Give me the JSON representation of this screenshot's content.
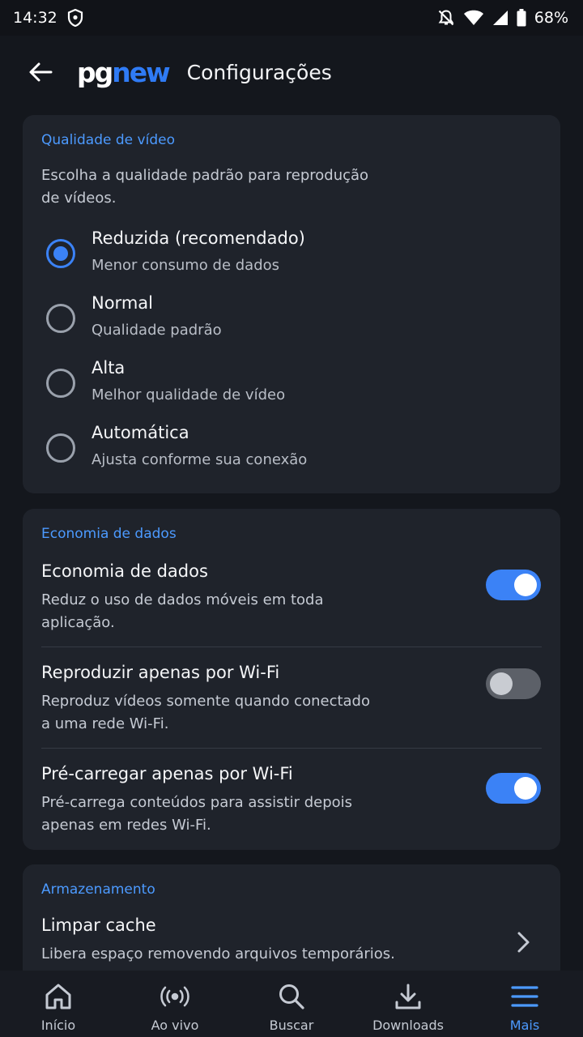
{
  "status_bar": {
    "time": "14:32",
    "battery": "68%",
    "icons": [
      "shield-icon",
      "notifications-off-icon",
      "wifi-icon",
      "signal-icon",
      "battery-icon"
    ]
  },
  "app_bar": {
    "logo_part1": "pg",
    "logo_part2": "new",
    "title": "Configurações",
    "back_icon": "arrow-back-icon"
  },
  "video_quality": {
    "section_title": "Qualidade de vídeo",
    "description": "Escolha a qualidade padrão para reprodução de vídeos.",
    "selected": "reduzida",
    "options": [
      {
        "id": "reduzida",
        "title": "Reduzida (recomendado)",
        "subtitle": "Menor consumo de dados"
      },
      {
        "id": "normal",
        "title": "Normal",
        "subtitle": "Qualidade padrão"
      },
      {
        "id": "alta",
        "title": "Alta",
        "subtitle": "Melhor qualidade de vídeo"
      },
      {
        "id": "automatica",
        "title": "Automática",
        "subtitle": "Ajusta conforme sua conexão"
      }
    ]
  },
  "data_saving": {
    "section_title": "Economia de dados",
    "items": [
      {
        "title": "Economia de dados",
        "subtitle": "Reduz o uso de dados móveis em toda aplicação.",
        "enabled": true
      },
      {
        "title": "Reproduzir apenas por Wi-Fi",
        "subtitle": "Reproduz vídeos somente quando conectado a uma rede Wi-Fi.",
        "enabled": false
      },
      {
        "title": "Pré-carregar apenas por Wi-Fi",
        "subtitle": "Pré-carrega conteúdos para assistir depois apenas em redes Wi-Fi.",
        "enabled": true
      }
    ]
  },
  "storage": {
    "section_title": "Armazenamento",
    "items": [
      {
        "title": "Limpar cache",
        "subtitle": "Libera espaço removendo arquivos temporários."
      }
    ]
  },
  "bottom_nav": {
    "active": "Mais",
    "items": [
      {
        "label": "Início",
        "icon": "home-icon"
      },
      {
        "label": "Ao vivo",
        "icon": "live-icon"
      },
      {
        "label": "Buscar",
        "icon": "search-icon"
      },
      {
        "label": "Downloads",
        "icon": "download-icon"
      },
      {
        "label": "Mais",
        "icon": "menu-icon"
      }
    ]
  },
  "colors": {
    "accent": "#3b82f6",
    "section_title": "#4c9aff",
    "background": "#14171d",
    "card": "#1f232b"
  }
}
